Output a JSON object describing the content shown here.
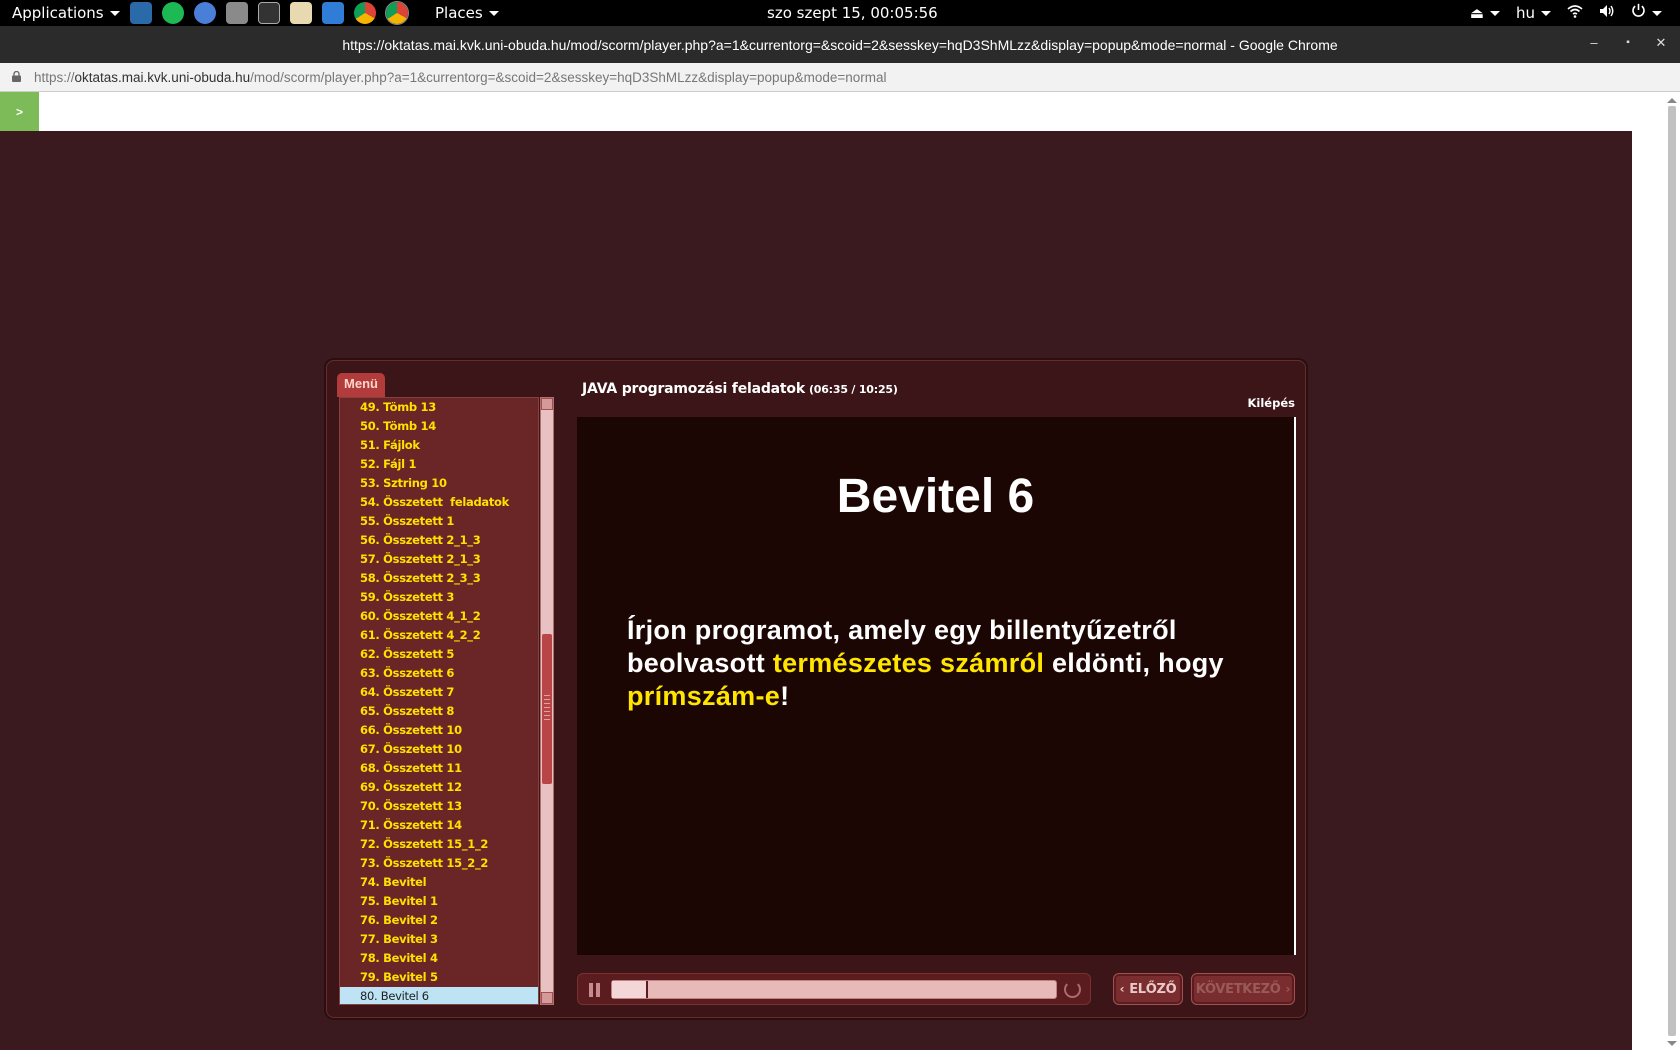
{
  "topbar": {
    "applications_label": "Applications",
    "places_label": "Places",
    "clock": "szo szept 15, 00:05:56",
    "keyboard_layout": "hu",
    "launcher_icons": [
      "desktop-icon",
      "spotify-icon",
      "chromium-icon",
      "screenshot-icon",
      "terminal-icon",
      "text-editor-icon",
      "system-monitor-icon",
      "chrome-icon",
      "chrome-active-icon"
    ]
  },
  "window": {
    "title": "https://oktatas.mai.kvk.uni-obuda.hu/mod/scorm/player.php?a=1&currentorg=&scoid=2&sesskey=hqD3ShMLzz&display=popup&mode=normal - Google Chrome"
  },
  "address": {
    "scheme": "https://",
    "host": "oktatas.mai.kvk.uni-obuda.hu",
    "path": "/mod/scorm/player.php?a=1&currentorg=&scoid=2&sesskey=hqD3ShMLzz&display=popup&mode=normal"
  },
  "page": {
    "toggle_label": ">"
  },
  "player": {
    "menu_tab": "Menü",
    "course_title": "JAVA programozási feladatok",
    "time": "(06:35 / 10:25)",
    "exit_label": "Kilépés",
    "menu_items": [
      "49. Tömb 13",
      "50. Tömb 14",
      "51. Fájlok",
      "52. Fájl 1",
      "53. Sztring 10",
      "54. Összetett  feladatok",
      "55. Összetett 1",
      "56. Összetett 2_1_3",
      "57. Összetett 2_1_3",
      "58. Összetett 2_3_3",
      "59. Összetett 3",
      "60. Összetett 4_1_2",
      "61. Összetett 4_2_2",
      "62. Összetett 5",
      "63. Összetett 6",
      "64. Összetett 7",
      "65. Összetett 8",
      "66. Összetett 10",
      "67. Összetett 10",
      "68. Összetett 11",
      "69. Összetett 12",
      "70. Összetett 13",
      "71. Összetett 14",
      "72. Összetett 15_1_2",
      "73. Összetett 15_2_2",
      "74. Bevitel",
      "75. Bevitel 1",
      "76. Bevitel 2",
      "77. Bevitel 3",
      "78. Bevitel 4",
      "79. Bevitel 5",
      "80. Bevitel 6"
    ],
    "selected_index": 31,
    "slide": {
      "heading": "Bevitel 6",
      "text_1": "Írjon programot, amely egy billentyűzetről beolvasott ",
      "highlight_1": "természetes számról",
      "text_2": " eldönti, hogy ",
      "highlight_2": "prímszám-e",
      "text_3": "!"
    },
    "progress_fraction": 0.08,
    "prev_label": "ELŐZŐ",
    "next_label": "KÖVETKEZŐ"
  },
  "colors": {
    "background": "#3a1a1e",
    "highlight_yellow": "#ffe600",
    "menu_text": "#ffe100",
    "selected_item_bg": "#bde3f5"
  }
}
